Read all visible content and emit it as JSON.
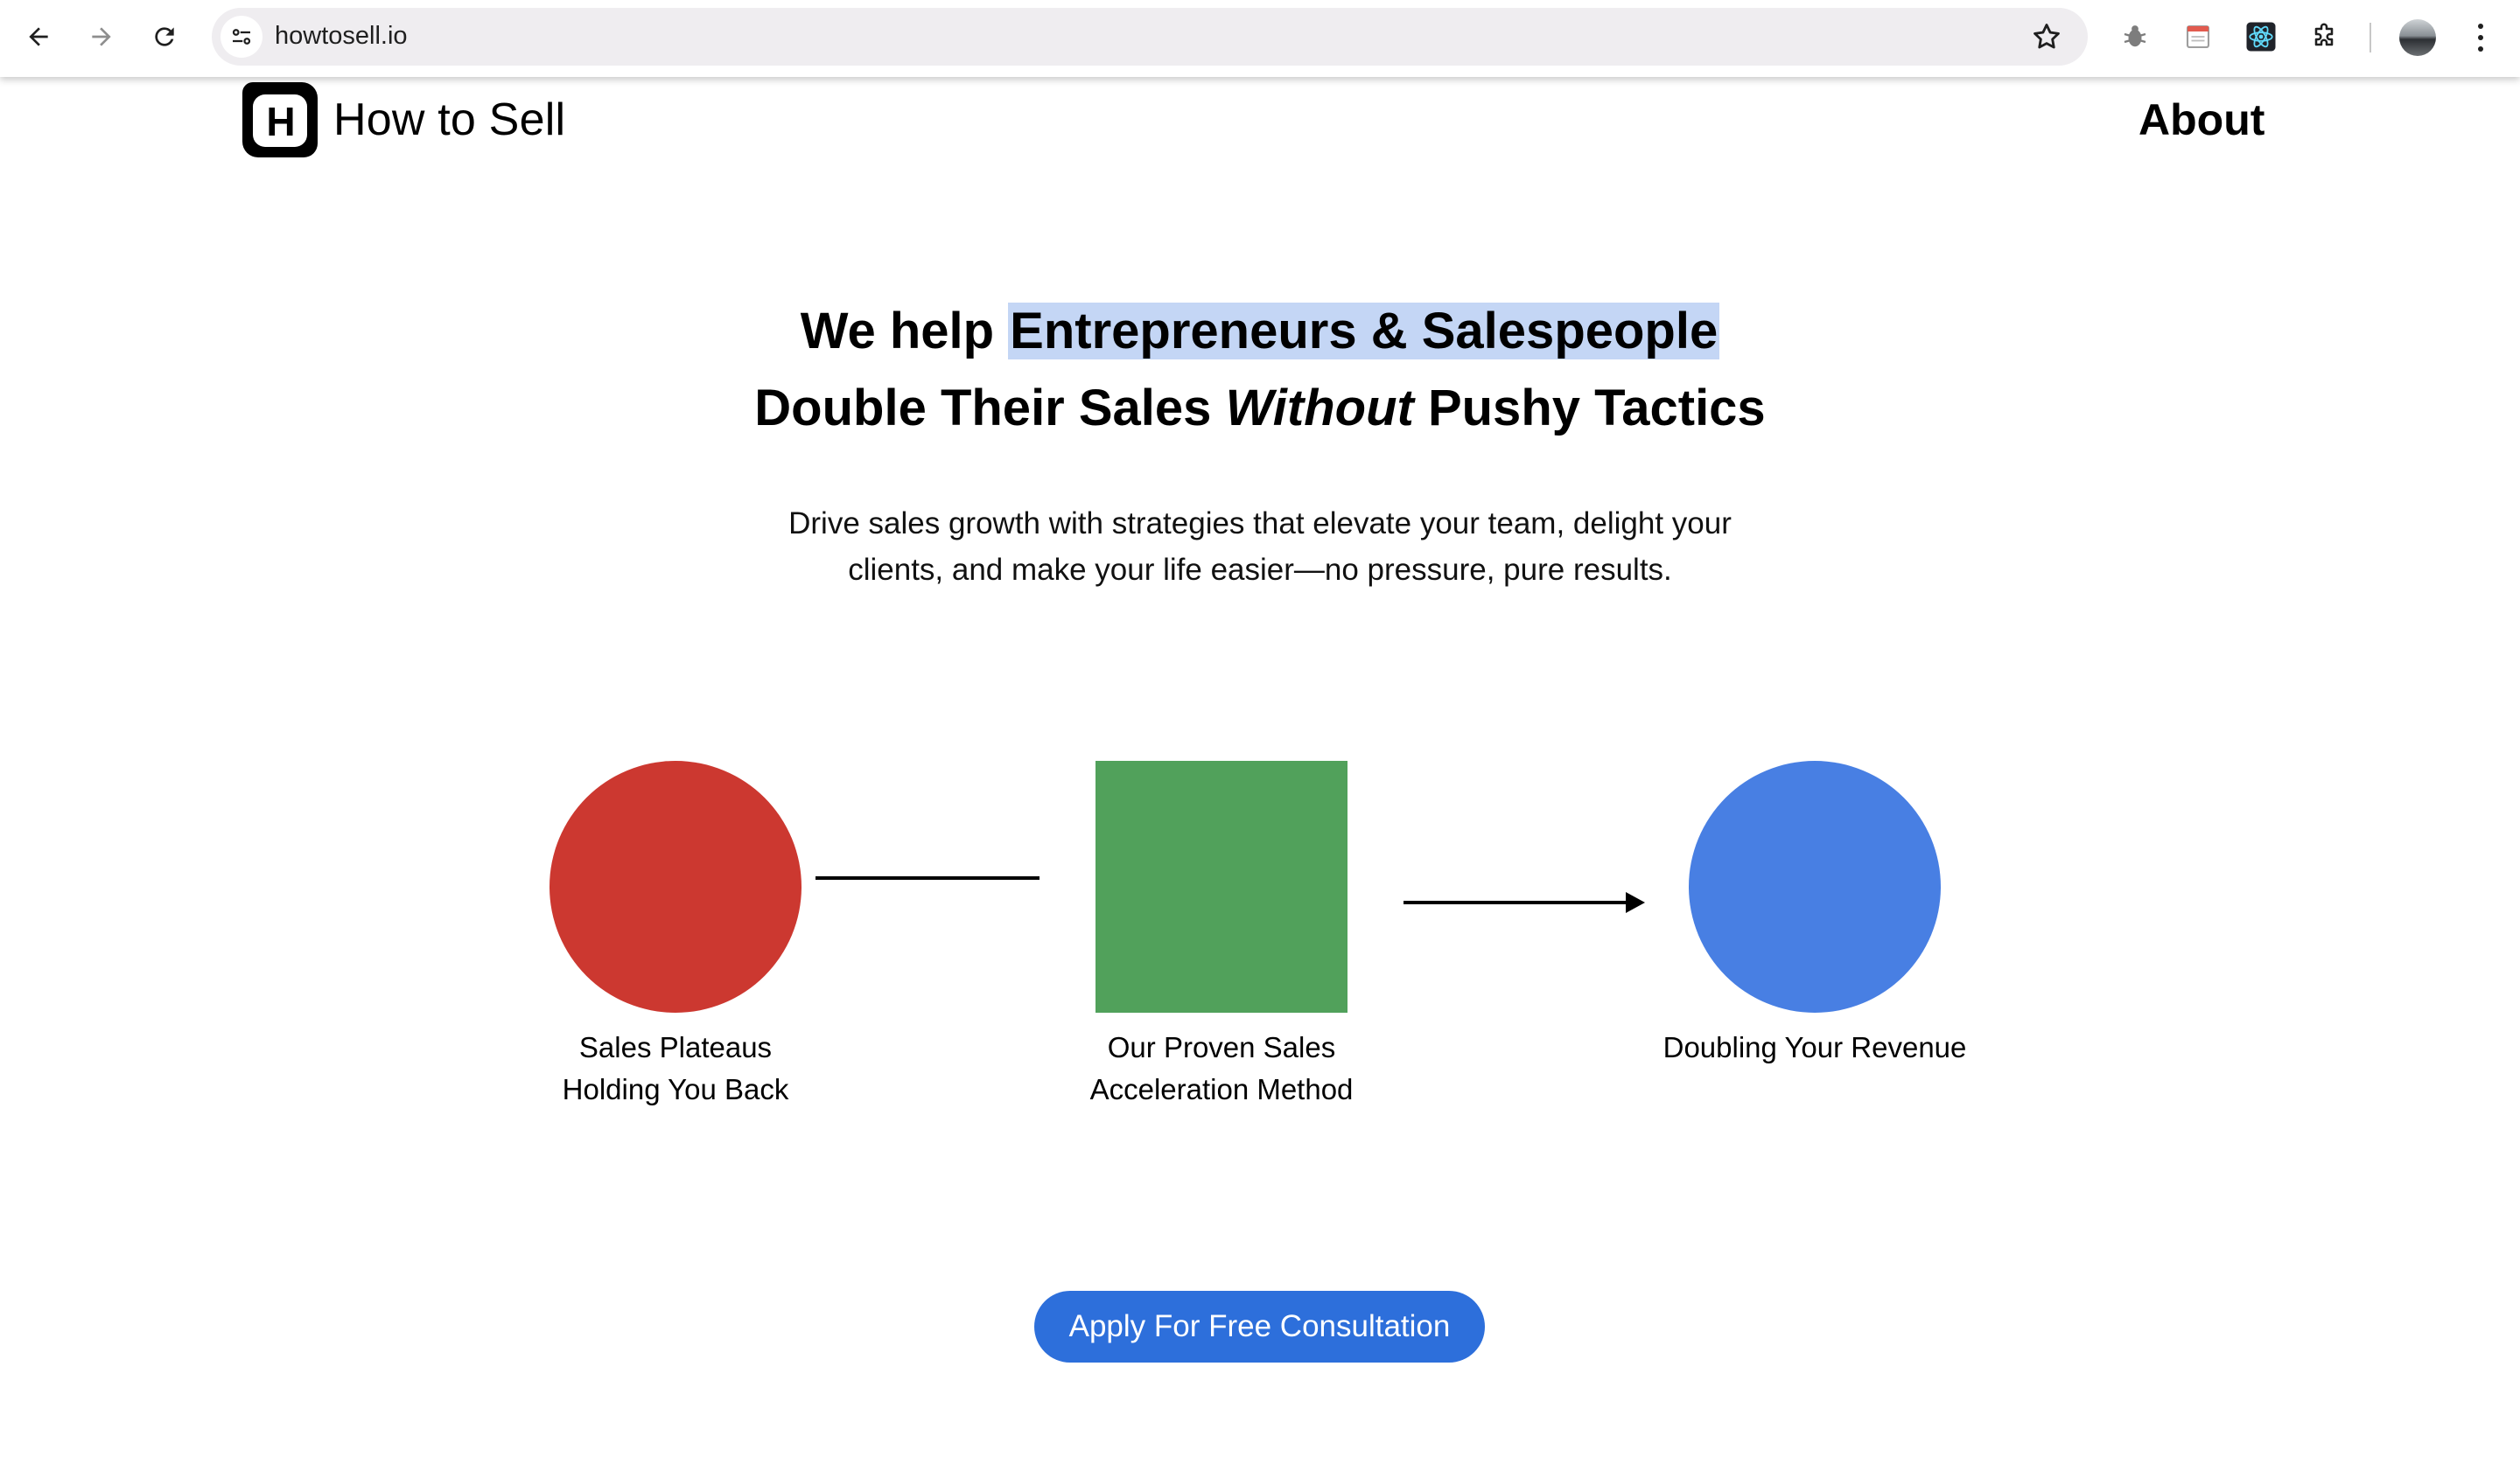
{
  "browser": {
    "url": "howtosell.io",
    "icons": [
      "back-arrow-icon",
      "forward-arrow-icon",
      "reload-icon",
      "site-info-icon",
      "bookmark-star-icon",
      "bug-extension-icon",
      "calendar-extension-icon",
      "react-devtools-icon",
      "puzzle-extensions-icon",
      "profile-avatar",
      "more-vert-icon"
    ]
  },
  "header": {
    "logo_letter": "H",
    "brand": "How to Sell",
    "nav_about": "About"
  },
  "hero": {
    "headline_prefix": "We help ",
    "headline_highlight": "Entrepreneurs & Salespeople",
    "headline_line2_a": "Double Their Sales ",
    "headline_line2_em": "Without",
    "headline_line2_b": " Pushy Tactics",
    "subtext_line1": "Drive sales growth with strategies that elevate your team, delight your",
    "subtext_line2": "clients, and make your life easier—no pressure, pure results."
  },
  "diagram": {
    "steps": [
      {
        "line1": "Sales Plateaus",
        "line2": "Holding You Back",
        "color": "#cc3830",
        "shape": "circle"
      },
      {
        "line1": "Our Proven Sales",
        "line2": "Acceleration Method",
        "color": "#51a15b",
        "shape": "square"
      },
      {
        "line1": "Doubling Your Revenue",
        "line2": "",
        "color": "#487fe3",
        "shape": "circle"
      }
    ]
  },
  "cta": {
    "label": "Apply For Free Consultation",
    "color": "#2d6fdb"
  },
  "colors": {
    "highlight": "#c4d6f5"
  }
}
